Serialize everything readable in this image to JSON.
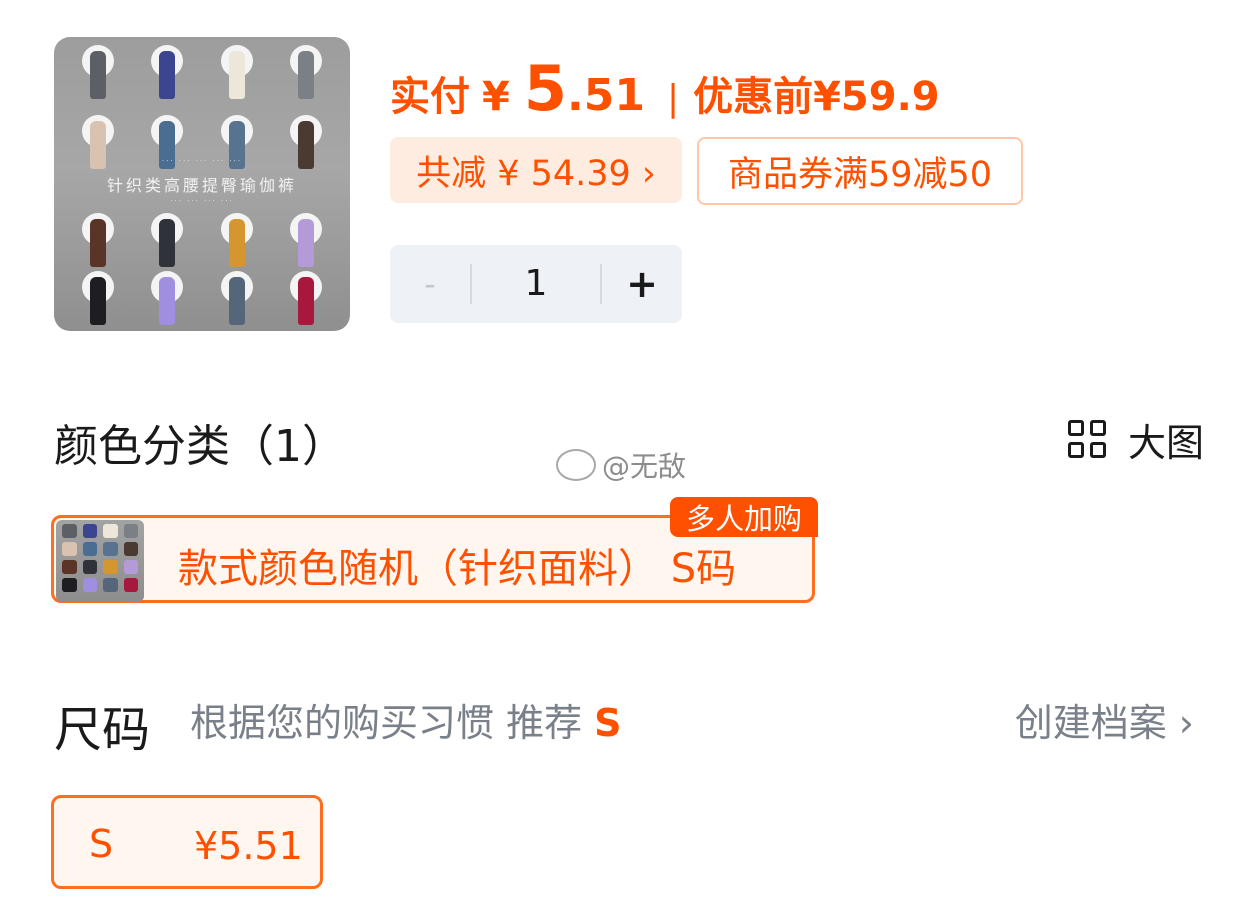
{
  "product": {
    "thumbnail_caption": "针织类高腰提臀瑜伽裤"
  },
  "price": {
    "paid_label": "实付",
    "currency": "¥",
    "paid_int": "5",
    "paid_dec": ".51",
    "separator": "|",
    "original_label": "优惠前",
    "original_price": "¥59.9"
  },
  "discount": {
    "total_label": "共减 ¥ 54.39 ›",
    "coupon_label": "商品券满59减50"
  },
  "quantity": {
    "minus": "-",
    "value": "1",
    "plus": "+"
  },
  "color_section": {
    "title": "颜色分类（1）",
    "big_view_label": "大图",
    "options": [
      {
        "label": "款式颜色随机（针织面料） S码",
        "tag": "多人加购",
        "selected": true
      }
    ]
  },
  "watermark": "@无敌",
  "size_section": {
    "title": "尺码",
    "hint_prefix": "根据您的购买习惯 推荐 ",
    "hint_size": "S",
    "create_profile": "创建档案 ›",
    "options": [
      {
        "size": "S",
        "price": "¥5.51",
        "selected": true
      }
    ]
  },
  "colors": {
    "accent": "#ff5000",
    "accent_border": "#ff6d1f",
    "chip_bg": "#ffece1",
    "stepper_bg": "#eef2f7"
  }
}
